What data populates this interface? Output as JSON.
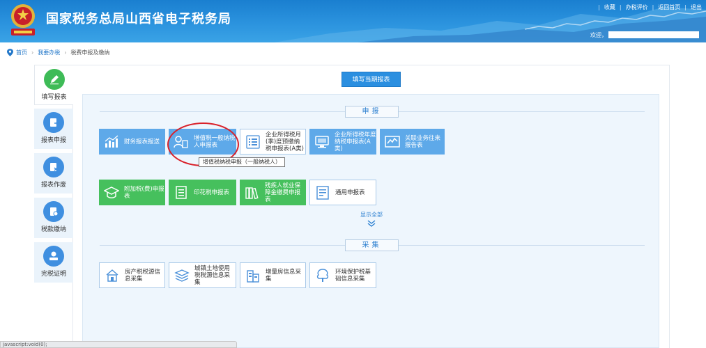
{
  "header": {
    "title": "国家税务总局山西省电子税务局",
    "links": [
      "收藏",
      "办税评价",
      "返回首页",
      "退出"
    ],
    "welcome": "欢迎，",
    "brand_color": "#1a7fd0"
  },
  "breadcrumb": {
    "items": [
      "首页",
      "我要办税",
      "税费申报及缴纳"
    ]
  },
  "sidebar": {
    "items": [
      {
        "label": "填写报表",
        "icon": "pencil-icon",
        "active": true
      },
      {
        "label": "报表申报",
        "icon": "report-submit-icon"
      },
      {
        "label": "报表作废",
        "icon": "report-void-icon"
      },
      {
        "label": "税款缴纳",
        "icon": "tax-payment-icon"
      },
      {
        "label": "完税证明",
        "icon": "tax-certificate-icon"
      }
    ]
  },
  "main": {
    "fill_current_button": "填写当期报表",
    "declare_section": "申报",
    "collect_section": "采集",
    "show_all": "显示全部",
    "declare_cards": [
      {
        "label": "财务报表报送",
        "icon": "chart-bars-icon",
        "style": "blue"
      },
      {
        "label": "增值税一般纳税人申报表",
        "icon": "person-form-icon",
        "style": "blue"
      },
      {
        "label": "企业所得税月(季)度预缴纳税申报表(A类)",
        "icon": "list-icon",
        "style": "white"
      },
      {
        "label": "企业所得税年度纳税申报表(A类)",
        "icon": "monitor-icon",
        "style": "blue"
      },
      {
        "label": "关联业务往来报告表",
        "icon": "trend-icon",
        "style": "blue"
      },
      {
        "label": "附加税(费)申报表",
        "icon": "graduation-cap-icon",
        "style": "green"
      },
      {
        "label": "印花税申报表",
        "icon": "document-icon",
        "style": "green"
      },
      {
        "label": "残疾人就业保障金缴费申报表",
        "icon": "books-icon",
        "style": "green"
      },
      {
        "label": "通用申报表",
        "icon": "form-icon",
        "style": "white"
      }
    ],
    "tooltip": "增值税纳税申报（一般纳税人）",
    "collect_cards": [
      {
        "label": "房产税税源信息采集",
        "icon": "house-icon"
      },
      {
        "label": "城镇土地使用税税源信息采集",
        "icon": "layers-icon"
      },
      {
        "label": "增量房信息采集",
        "icon": "building-icon"
      },
      {
        "label": "环境保护税基础信息采集",
        "icon": "tree-icon"
      }
    ]
  },
  "status_bar": {
    "text": "javascript:void(0);"
  }
}
